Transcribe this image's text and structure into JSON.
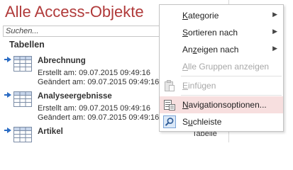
{
  "nav_pane": {
    "title": "Alle Access-Objekte",
    "search_placeholder": "Suchen...",
    "section": "Tabellen",
    "objects": [
      {
        "name": "Abrechnung",
        "created": "Erstellt am: 09.07.2015 09:49:16",
        "modified": "Geändert am: 09.07.2015 09:49:16"
      },
      {
        "name": "Analyseergebnisse",
        "created": "Erstellt am: 09.07.2015 09:49:16",
        "modified": "Geändert am: 09.07.2015 09:49:16"
      },
      {
        "name": "Artikel",
        "created": "",
        "modified": ""
      }
    ]
  },
  "right_pane": {
    "type_label": "Tabelle"
  },
  "context_menu": {
    "items": [
      {
        "label_pre": "",
        "label_key": "K",
        "label_post": "ategorie",
        "submenu": true,
        "disabled": false
      },
      {
        "label_pre": "",
        "label_key": "S",
        "label_post": "ortieren nach",
        "submenu": true,
        "disabled": false
      },
      {
        "label_pre": "An",
        "label_key": "z",
        "label_post": "eigen nach",
        "submenu": true,
        "disabled": false
      },
      {
        "label_pre": "",
        "label_key": "A",
        "label_post": "lle Gruppen anzeigen",
        "submenu": false,
        "disabled": true
      },
      {
        "label_pre": "",
        "label_key": "E",
        "label_post": "infügen",
        "submenu": false,
        "disabled": true
      },
      {
        "label_pre": "",
        "label_key": "N",
        "label_post": "avigationsoptionen...",
        "submenu": false,
        "disabled": false
      },
      {
        "label_pre": "S",
        "label_key": "u",
        "label_post": "chleiste",
        "submenu": false,
        "disabled": false
      }
    ],
    "submenu_glyph": "▶"
  },
  "colors": {
    "title": "#b03a3a",
    "hover": "#f7dfdf",
    "accent": "#2b6cc4"
  }
}
